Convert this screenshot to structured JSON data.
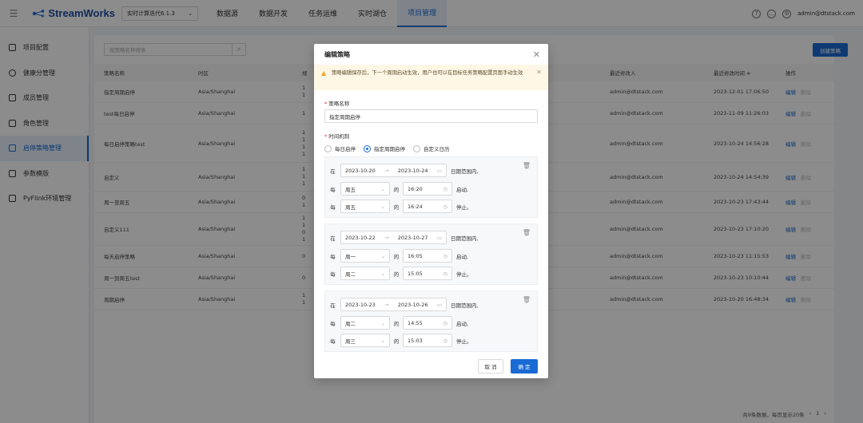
{
  "header": {
    "brand": "StreamWorks",
    "project": "实时计算迭代6.1.3",
    "nav": [
      "数据源",
      "数据开发",
      "任务运维",
      "实时湖仓",
      "项目管理"
    ],
    "active_nav": 4,
    "user": "admin@dtstack.com"
  },
  "sidebar": {
    "items": [
      "项目配置",
      "健康分管理",
      "成员管理",
      "角色管理",
      "启停策略管理",
      "参数模版",
      "PyFlink环境管理"
    ],
    "active": 4
  },
  "main": {
    "search_placeholder": "按策略名称搜索",
    "create_label": "创建策略",
    "columns": [
      "策略名称",
      "时区",
      "规",
      "最近修改人",
      "最近修改时间 ≑",
      "操作"
    ],
    "rows": [
      {
        "name": "指定周期启停",
        "tz": "Asia/Shanghai",
        "rule": "1\n1",
        "user": "admin@dtstack.com",
        "time": "2023-12-01 17:06:50"
      },
      {
        "name": "test每日启停",
        "tz": "Asia/Shanghai",
        "rule": "1",
        "user": "admin@dtstack.com",
        "time": "2023-11-09 11:26:03"
      },
      {
        "name": "每日启停策略test",
        "tz": "Asia/Shanghai",
        "rule": "1\n1\n1\n1",
        "user": "admin@dtstack.com",
        "time": "2023-10-24 14:56:28"
      },
      {
        "name": "自定义",
        "tz": "Asia/Shanghai",
        "rule": "1\n1\n1",
        "user": "admin@dtstack.com",
        "time": "2023-10-24 14:54:39"
      },
      {
        "name": "周一至周五",
        "tz": "Asia/Shanghai",
        "rule": "0\n1",
        "user": "admin@dtstack.com",
        "time": "2023-10-23 17:43:44"
      },
      {
        "name": "自定义111",
        "tz": "Asia/Shanghai",
        "rule": "1\n1\n0\n1",
        "user": "admin@dtstack.com",
        "time": "2023-10-23 17:10:20"
      },
      {
        "name": "每天启停策略",
        "tz": "Asia/Shanghai",
        "rule": "0",
        "user": "admin@dtstack.com",
        "time": "2023-10-23 11:15:53"
      },
      {
        "name": "周一到周五test",
        "tz": "Asia/Shanghai",
        "rule": "0",
        "user": "admin@dtstack.com",
        "time": "2023-10-23 10:10:44"
      },
      {
        "name": "周期启停",
        "tz": "Asia/Shanghai",
        "rule": "1\n1",
        "user": "admin@dtstack.com",
        "time": "2023-10-20 16:48:34"
      }
    ],
    "edit_label": "编辑",
    "delete_label": "删除",
    "footer": "共9条数据，每页显示20条",
    "page": "1"
  },
  "modal": {
    "title": "编辑策略",
    "warning": "策略编辑保存后，下一个周期启动生效，用户也可以在目标任务策略配置页面手动生效",
    "name_label": "策略名称",
    "name_value": "指定周期启停",
    "time_label": "时间机制",
    "radio_options": [
      "每日启停",
      "指定周期启停",
      "自定义日历"
    ],
    "radio_selected": 1,
    "in_label": "在",
    "range_suffix": "日期范围内,",
    "every_label": "每",
    "of_label": "的",
    "start_suffix": "启动,",
    "stop_suffix": "停止。",
    "blocks": [
      {
        "start": "2023-10-20",
        "end": "2023-10-24",
        "start_day": "周五",
        "start_time": "16:20",
        "stop_day": "周五",
        "stop_time": "16:24"
      },
      {
        "start": "2023-10-22",
        "end": "2023-10-27",
        "start_day": "周一",
        "start_time": "16:05",
        "stop_day": "周二",
        "stop_time": "15:05"
      },
      {
        "start": "2023-10-23",
        "end": "2023-10-26",
        "start_day": "周二",
        "start_time": "14:55",
        "stop_day": "周三",
        "stop_time": "15:03"
      }
    ],
    "cancel_label": "取 消",
    "ok_label": "确 定"
  },
  "colors": {
    "primary": "#1a6ad3",
    "warning_bg": "#fff7e6"
  }
}
